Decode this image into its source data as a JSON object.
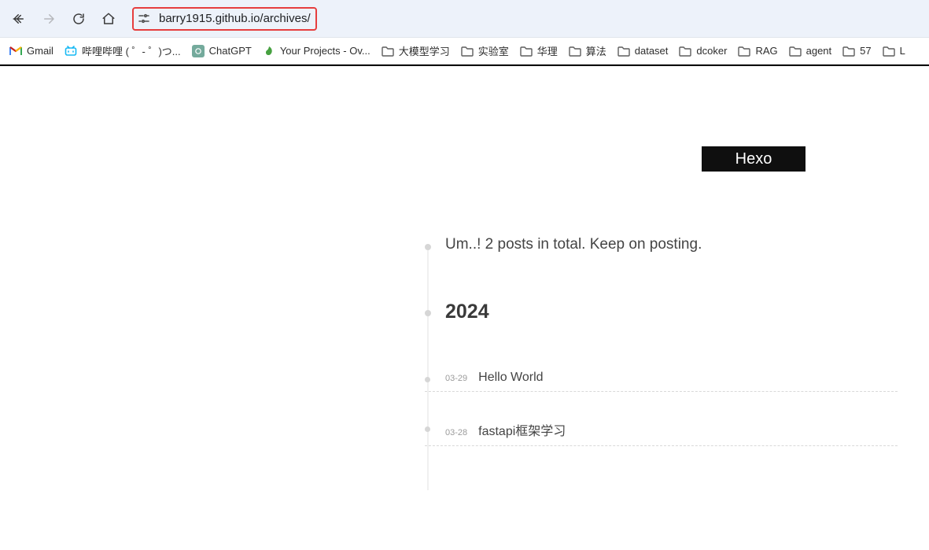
{
  "browser": {
    "url": "barry1915.github.io/archives/"
  },
  "bookmarks": [
    {
      "type": "gmail",
      "label": "Gmail"
    },
    {
      "type": "bili",
      "label": "哔哩哔哩 ( ゜- ゜)つ..."
    },
    {
      "type": "chatgpt",
      "label": "ChatGPT"
    },
    {
      "type": "overleaf",
      "label": "Your Projects - Ov..."
    },
    {
      "type": "folder",
      "label": "大模型学习"
    },
    {
      "type": "folder",
      "label": "实验室"
    },
    {
      "type": "folder",
      "label": "华理"
    },
    {
      "type": "folder",
      "label": "算法"
    },
    {
      "type": "folder",
      "label": "dataset"
    },
    {
      "type": "folder",
      "label": "dcoker"
    },
    {
      "type": "folder",
      "label": "RAG"
    },
    {
      "type": "folder",
      "label": "agent"
    },
    {
      "type": "folder",
      "label": "57"
    },
    {
      "type": "folder",
      "label": "L"
    }
  ],
  "page": {
    "site_title": "Hexo",
    "summary": "Um..! 2 posts in total. Keep on posting.",
    "year": "2024",
    "posts": [
      {
        "date": "03-29",
        "title": "Hello World"
      },
      {
        "date": "03-28",
        "title": "fastapi框架学习"
      }
    ]
  }
}
